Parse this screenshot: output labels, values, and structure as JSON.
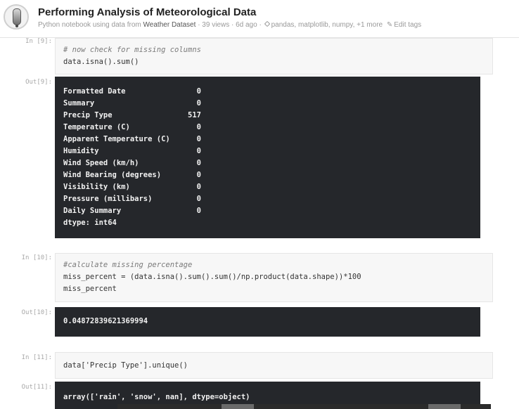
{
  "header": {
    "title": "Performing Analysis of Meteorological Data",
    "meta_prefix": "Python notebook using data from",
    "dataset": "Weather Dataset",
    "meta_stats": "· 39 views · 6d ago ·",
    "tags": "pandas, matplotlib, numpy, +1 more",
    "edit_tags": "Edit tags",
    "avatar_icon": "wine-glass-icon"
  },
  "cells": {
    "c9": {
      "in_prompt": "In [9]:",
      "comment": "# now check for missing columns",
      "code": "data.isna().sum()",
      "out_prompt": "Out[9]:",
      "series": [
        {
          "k": "Formatted Date",
          "v": "0"
        },
        {
          "k": "Summary",
          "v": "0"
        },
        {
          "k": "Precip Type",
          "v": "517"
        },
        {
          "k": "Temperature (C)",
          "v": "0"
        },
        {
          "k": "Apparent Temperature (C)",
          "v": "0"
        },
        {
          "k": "Humidity",
          "v": "0"
        },
        {
          "k": "Wind Speed (km/h)",
          "v": "0"
        },
        {
          "k": "Wind Bearing (degrees)",
          "v": "0"
        },
        {
          "k": "Visibility (km)",
          "v": "0"
        },
        {
          "k": "Pressure (millibars)",
          "v": "0"
        },
        {
          "k": "Daily Summary",
          "v": "0"
        }
      ],
      "dtype": "dtype: int64"
    },
    "c10": {
      "in_prompt": "In [10]:",
      "comment": "#calculate missing percentage",
      "code_line1": "miss_percent = (data.isna().sum().sum()/np.product(data.shape))*100",
      "code_line2": "miss_percent",
      "out_prompt": "Out[10]:",
      "output": "0.04872839621369994"
    },
    "c11": {
      "in_prompt": "In [11]:",
      "code": "data['Precip Type'].unique()",
      "out_prompt": "Out[11]:",
      "output": "array(['rain', 'snow', nan], dtype=object)"
    }
  },
  "colors": {
    "output_bg": "#25272b",
    "code_bg": "#f7f7f7"
  }
}
